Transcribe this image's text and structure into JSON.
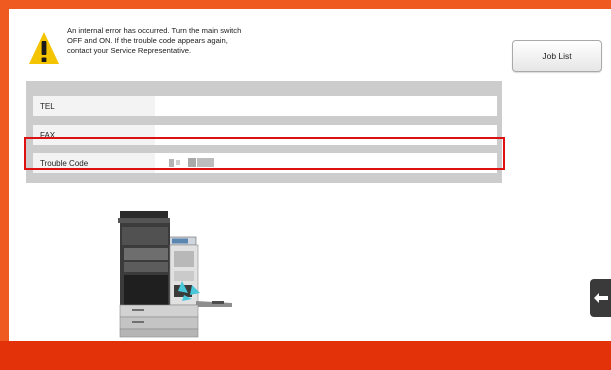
{
  "alert": {
    "icon": "warning-icon",
    "lines": [
      "An internal error has occurred. Turn the main switch",
      "OFF and ON.  If the trouble code appears again,",
      "contact your Service Representative."
    ]
  },
  "job_list_button": {
    "label": "Job List"
  },
  "info_table": {
    "rows": [
      {
        "label": "TEL",
        "value": ""
      },
      {
        "label": "FAX",
        "value": ""
      },
      {
        "label": "Trouble Code",
        "value": ""
      }
    ]
  },
  "illustration": {
    "icon": "printer-jam-illustration"
  },
  "side_tab": {
    "icon": "left-arrow-icon"
  },
  "colors": {
    "frame_orange": "#ee5a1f",
    "footer_red": "#e3320a",
    "highlight_red": "#dd1111",
    "warning_yellow": "#f5c400"
  }
}
